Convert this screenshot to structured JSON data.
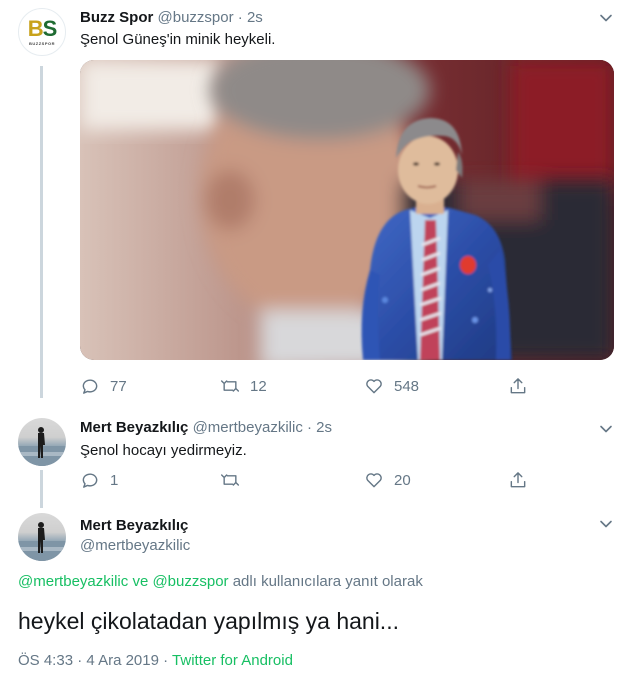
{
  "tweet1": {
    "display_name": "Buzz Spor",
    "handle": "@buzzspor",
    "separator": "·",
    "time": "2s",
    "text": "Şenol Güneş'in minik heykeli.",
    "avatar_letters": "BS",
    "avatar_caption": "BUZZSPOR",
    "replies": "77",
    "retweets": "12",
    "likes": "548"
  },
  "tweet2": {
    "display_name": "Mert Beyazkılıç",
    "handle": "@mertbeyazkilic",
    "separator": "·",
    "time": "2s",
    "text": "Şenol hocayı yedirmeyiz.",
    "replies": "1",
    "retweets": "",
    "likes": "20"
  },
  "tweet3": {
    "display_name": "Mert Beyazkılıç",
    "handle": "@mertbeyazkilic",
    "reply_user1": "@mertbeyazkilic",
    "reply_joiner": "ve",
    "reply_user2": "@buzzspor",
    "reply_suffix": "adlı kullanıcılara yanıt olarak",
    "text": "heykel çikolatadan yapılmış ya hani...",
    "time": "ÖS 4:33",
    "date": "4 Ara 2019",
    "separator": "·",
    "source": "Twitter for Android"
  },
  "colors": {
    "text": "#14171a",
    "secondary": "#657786",
    "link": "#1da1f2",
    "green": "#17bf63",
    "thread_line": "#ccd6dd"
  }
}
